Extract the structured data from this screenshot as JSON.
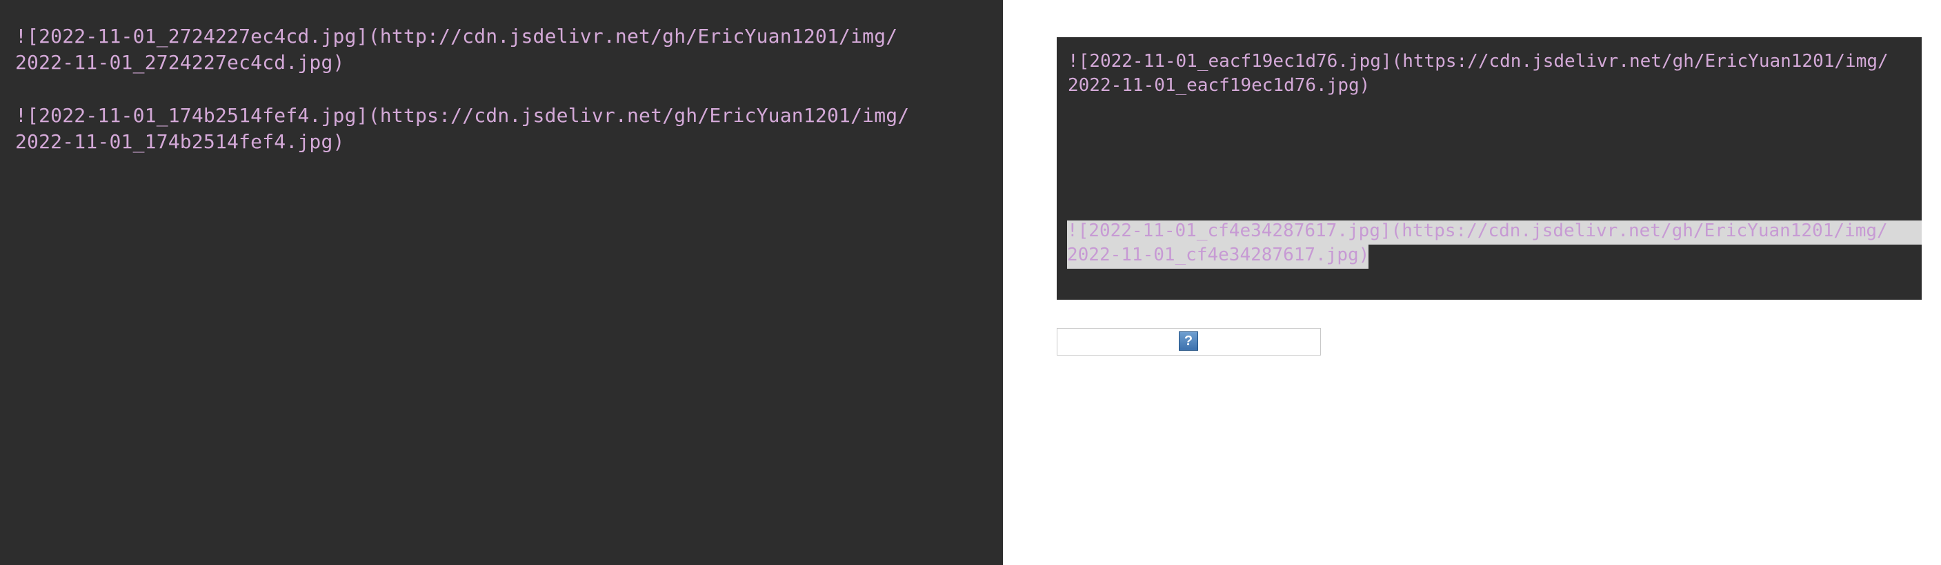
{
  "left_pane": {
    "lines": [
      "![2022-11-01_2724227ec4cd.jpg](http://cdn.jsdelivr.net/gh/EricYuan1201/img/",
      "2022-11-01_2724227ec4cd.jpg)",
      "![2022-11-01_174b2514fef4.jpg](https://cdn.jsdelivr.net/gh/EricYuan1201/img/",
      "2022-11-01_174b2514fef4.jpg)"
    ]
  },
  "right_pane": {
    "editor": {
      "lines": [
        "![2022-11-01_eacf19ec1d76.jpg](https://cdn.jsdelivr.net/gh/EricYuan1201/img/",
        "2022-11-01_eacf19ec1d76.jpg)",
        "![2022-11-01_cf4e34287617.jpg](https://cdn.jsdelivr.net/gh/EricYuan1201/img/",
        "2022-11-01_cf4e34287617.jpg)"
      ]
    },
    "help_button": {
      "label": "?",
      "icon": "help-icon"
    }
  },
  "colors": {
    "dark_background": "#2d2d2d",
    "text": "#d4a9d8",
    "selection": "#d9d9d9",
    "help_button": "#3d72ae"
  }
}
